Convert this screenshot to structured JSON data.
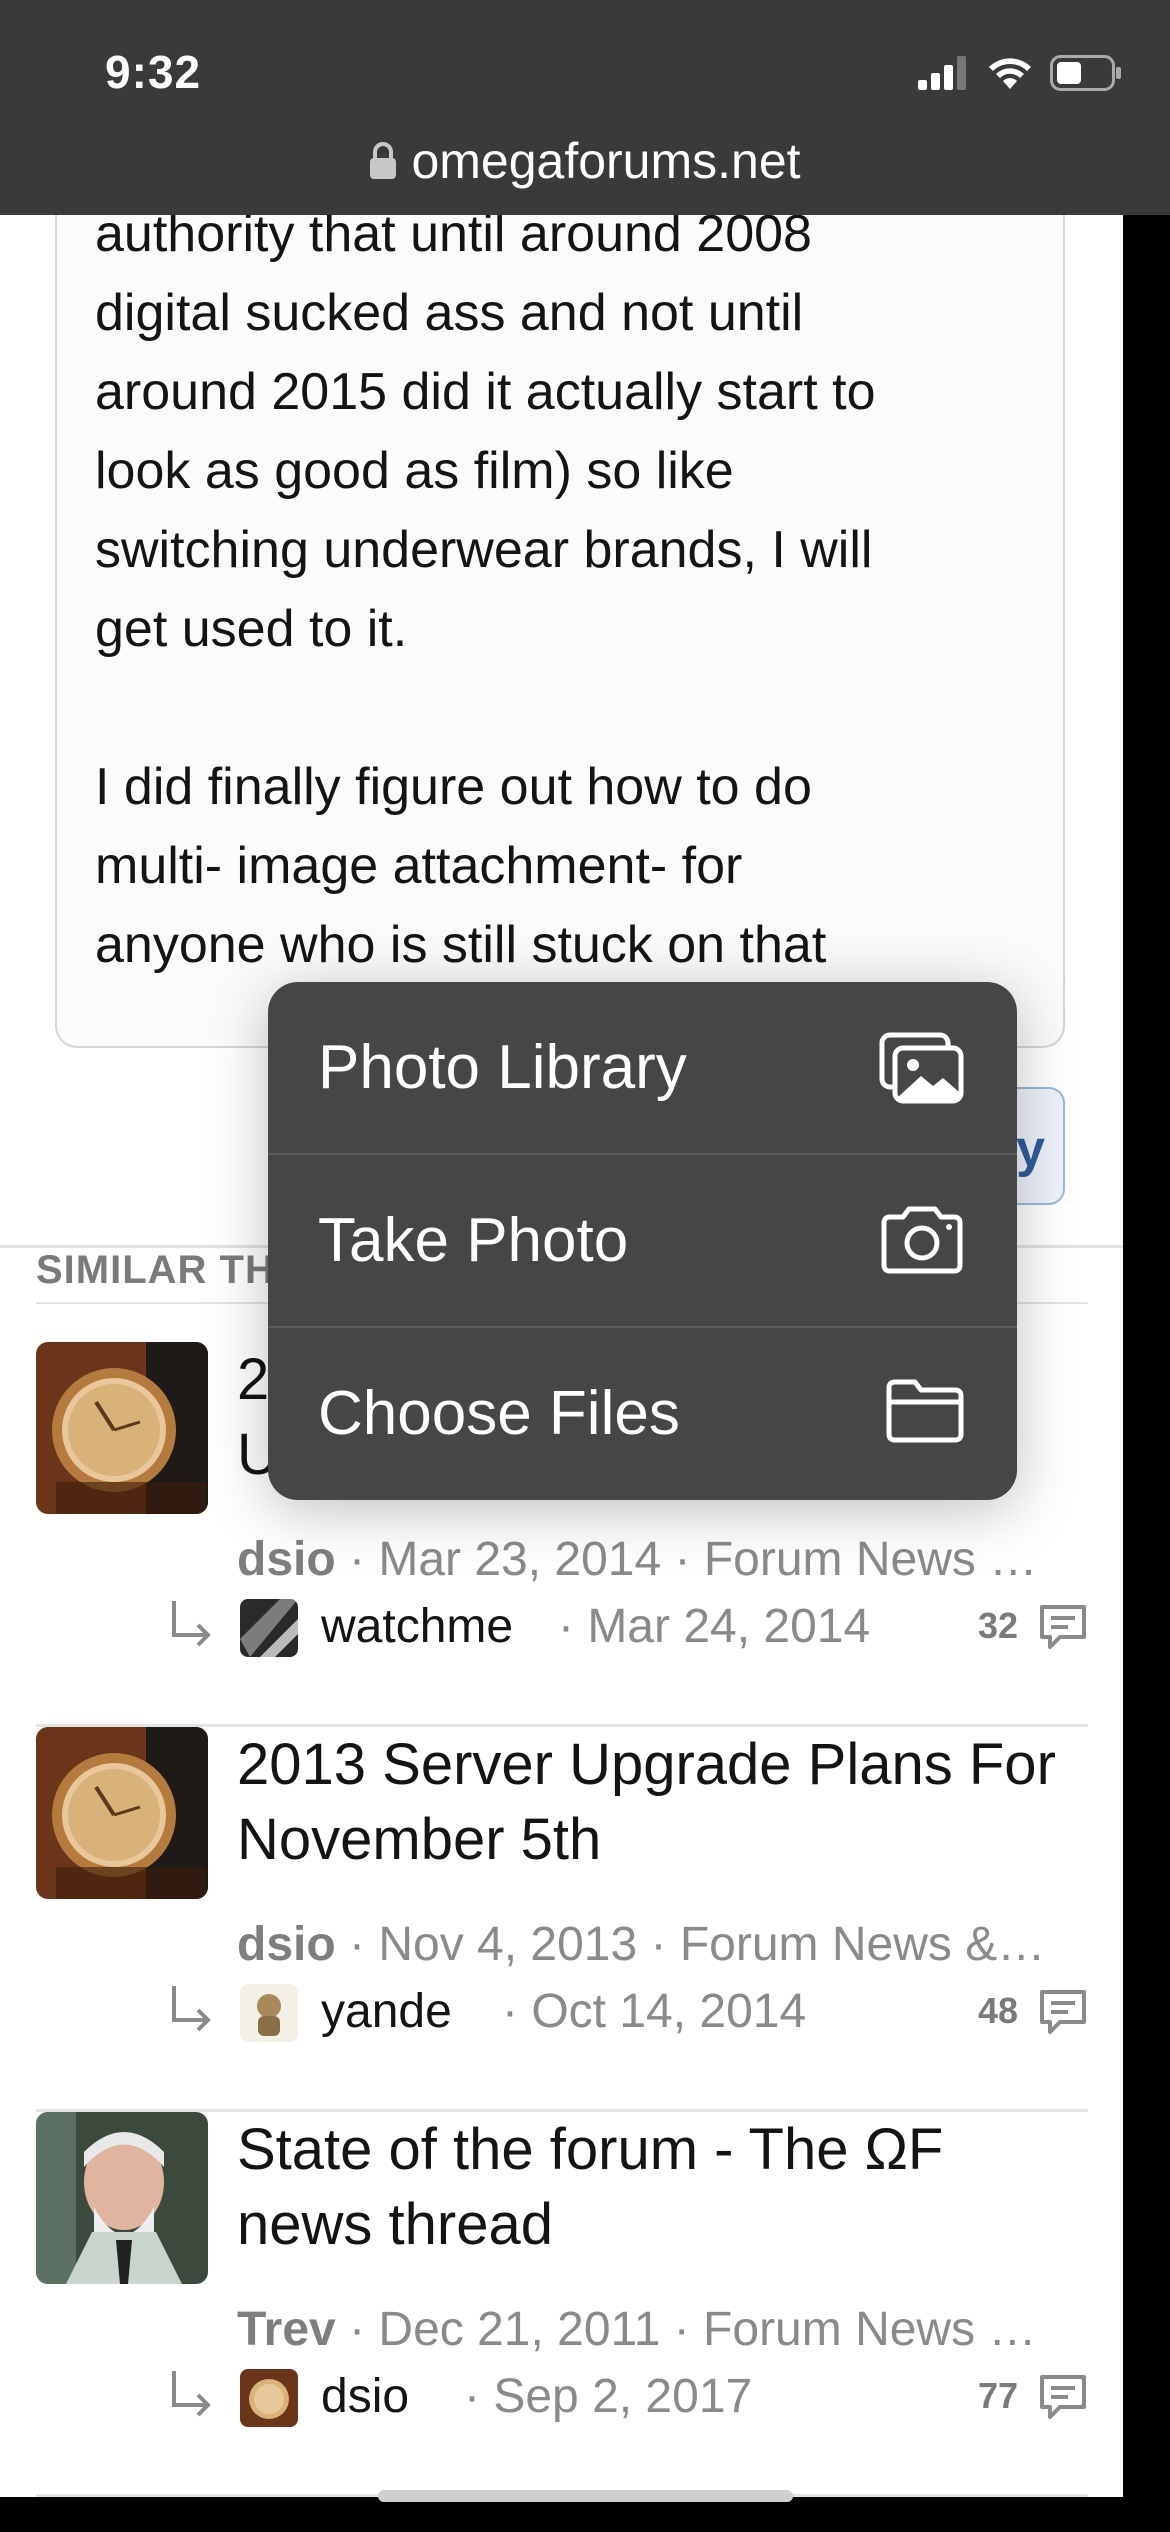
{
  "status_bar": {
    "time": "9:32",
    "url": "omegaforums.net"
  },
  "post": {
    "quote_text": "authority that until around 2008\ndigital sucked ass and not until\naround 2015 did it actually start to\nlook as good as film) so like\nswitching underwear brands, I will\nget used to it.\n\nI did finally figure out how to do\nmulti- image attachment- for\nanyone who is still stuck on that"
  },
  "similar": {
    "heading": "SIMILAR TH",
    "threads": [
      {
        "title": "2\nU",
        "author": "dsio",
        "date_section": "· Mar 23, 2014 · Forum News …",
        "last_user": "watchme",
        "last_date": "· Mar 24, 2014",
        "replies": "32"
      },
      {
        "title": "2013 Server Upgrade Plans For November 5th",
        "author": "dsio",
        "date_section": "· Nov 4, 2013 · Forum News &…",
        "last_user": "yande",
        "last_date": "· Oct 14, 2014",
        "replies": "48"
      },
      {
        "title": "State of the forum - The ΩF news thread",
        "author": "Trev",
        "date_section": "· Dec 21, 2011 · Forum News …",
        "last_user": "dsio",
        "last_date": "· Sep 2, 2017",
        "replies": "77"
      }
    ]
  },
  "menu": {
    "items": [
      {
        "label": "Photo Library",
        "icon": "photo-library-icon"
      },
      {
        "label": "Take Photo",
        "icon": "camera-icon"
      },
      {
        "label": "Choose Files",
        "icon": "folder-icon"
      }
    ]
  }
}
